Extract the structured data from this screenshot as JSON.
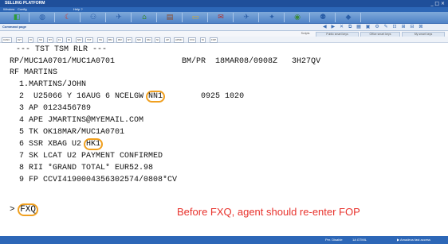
{
  "window": {
    "title": "SELLING PLATFORM",
    "controls": "_ □ ×"
  },
  "menu": {
    "items": [
      "Window",
      "Config",
      "Help ?"
    ]
  },
  "toolbar": {
    "buttons": [
      {
        "icon": "green-folder-icon",
        "glyph": "◧",
        "color": "#2e9b3a"
      },
      {
        "icon": "globe-icon",
        "glyph": "◍",
        "color": "#2b5fa8"
      },
      {
        "icon": "moon-icon",
        "glyph": "☾",
        "color": "#d13b2c"
      },
      {
        "icon": "people-icon",
        "glyph": "⚇",
        "color": "#2b5fa8"
      },
      {
        "icon": "plane-icon",
        "glyph": "✈",
        "color": "#2b5fa8"
      },
      {
        "icon": "house-icon",
        "glyph": "⌂",
        "color": "#3a8a3a"
      },
      {
        "icon": "book-icon",
        "glyph": "▤",
        "color": "#8a4a2a"
      },
      {
        "icon": "yellow-folder-icon",
        "glyph": "▭",
        "color": "#e0b020"
      },
      {
        "icon": "envelope-icon",
        "glyph": "✉",
        "color": "#b03030"
      },
      {
        "icon": "plane2-icon",
        "glyph": "✈",
        "color": "#2b5fa8"
      },
      {
        "icon": "pin-icon",
        "glyph": "✦",
        "color": "#2b5fa8"
      },
      {
        "icon": "disk-icon",
        "glyph": "◉",
        "color": "#3a8a3a"
      },
      {
        "icon": "people2-icon",
        "glyph": "⚉",
        "color": "#2b5fa8"
      },
      {
        "icon": "blue-icon",
        "glyph": "◆",
        "color": "#2b5fa8"
      }
    ]
  },
  "command_bar": {
    "label": "Command page",
    "icons": "◀ ▶ ✕ ⧉ ▦ ▣ ⚙ ✎ ⊡ ⊞ ⊟ ⊠"
  },
  "smart_keys": {
    "items": [
      "Scripts",
      "Public smart keys",
      "Office smart keys",
      "My smart keys"
    ]
  },
  "keys": [
    "CANC",
    "IGT",
    "XI",
    "SS",
    "NT",
    "FL",
    "NI",
    "NM",
    "TKT",
    "SS",
    "BM",
    "RM",
    "NT",
    "SM",
    "SM",
    "NI",
    "AP",
    "APMC",
    "FXU",
    "NI",
    "FOP"
  ],
  "terminal": {
    "lines": [
      "--- TST TSM RLR ---",
      "RP/MUC1A0701/MUC1A0701              BM/PR  18MAR08/0908Z   3H27QV",
      "RF MARTINS",
      "  1.MARTINS/JOHN",
      "  2  U25066 Y 16AUG 6 NCELGW ",
      "  3 AP 0123456789",
      "  4 APE JMARTINS@MYEMAIL.COM",
      "  5 TK OK18MAR/MUC1A0701",
      "  6 SSR XBAG U2 ",
      "  7 SK LCAT U2 PAYMENT CONFIRMED",
      "  8 RII *GRAND TOTAL* EUR52.98",
      "  9 FP CCVI4190004356302574/0808*CV"
    ],
    "seg_status": "NN1",
    "seg_times": "        0925 1020",
    "ssr_status": "HK1",
    "prompt": "> ",
    "command": "FXQ"
  },
  "annotation": "Before FXQ, agent should re-enter FOP",
  "colors": {
    "annotation": "#e8322c",
    "highlight": "#f0a020",
    "bar": "#2d67b7"
  },
  "status": {
    "left": "",
    "mid1": "Per. Disable",
    "mid2": "1A GTMIL",
    "right": "▶ Amadeus fast access"
  }
}
